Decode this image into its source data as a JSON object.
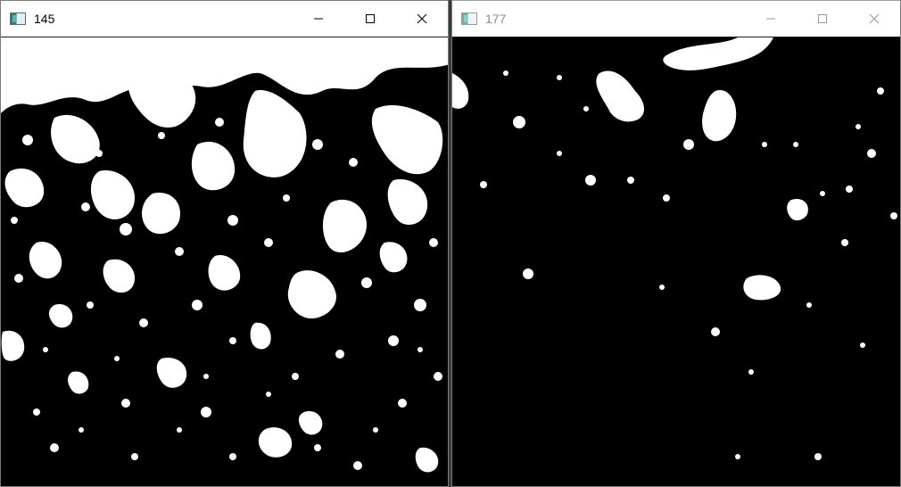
{
  "windows": [
    {
      "title": "145",
      "state": "active",
      "controls": [
        "minimize-icon",
        "maximize-icon",
        "close-icon"
      ]
    },
    {
      "title": "177",
      "state": "inactive",
      "controls": [
        "minimize-icon",
        "maximize-icon",
        "close-icon"
      ]
    }
  ],
  "colors": {
    "foreground_pixels": "#ffffff",
    "background_pixels": "#000000",
    "active_title": "#000000",
    "inactive_title": "#8c8c8c"
  }
}
